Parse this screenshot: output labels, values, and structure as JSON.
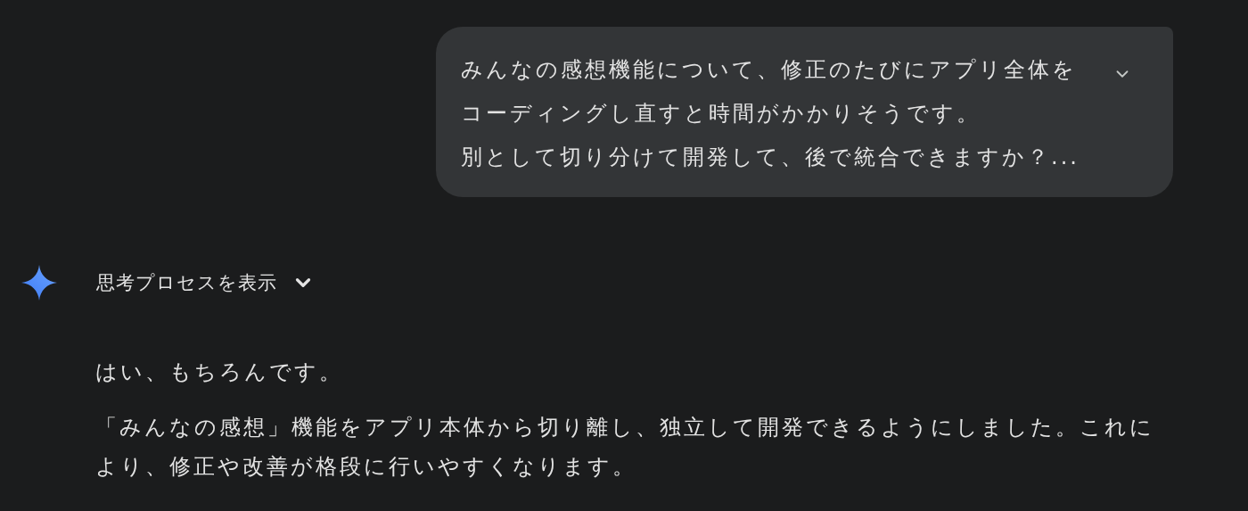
{
  "user_message": {
    "lines": [
      "みんなの感想機能について、修正のたびにアプリ全体を",
      "コーディングし直すと時間がかかりそうです。",
      "別として切り分けて開発して、後で統合できますか？..."
    ],
    "expanded": false
  },
  "response": {
    "thinking_toggle": {
      "label": "思考プロセスを表示",
      "expanded": false
    },
    "paragraphs": [
      "はい、もちろんです。",
      "「みんなの感想」機能をアプリ本体から切り離し、独立して開発できるようにしました。これにより、修正や改善が格段に行いやすくなります。"
    ]
  }
}
